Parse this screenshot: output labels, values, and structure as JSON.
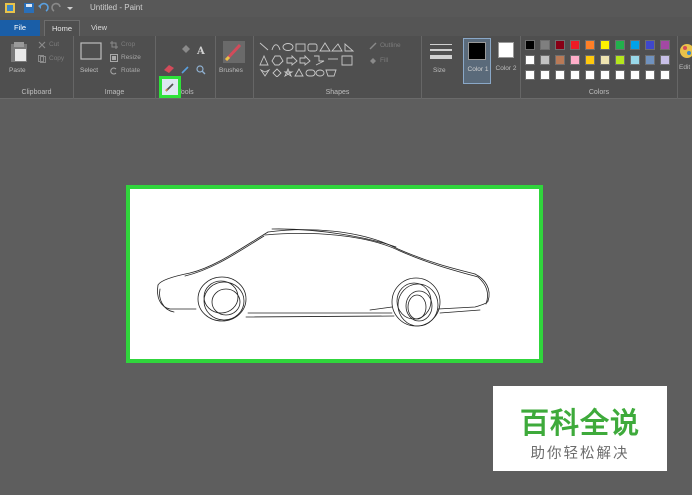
{
  "window": {
    "title": "Untitled - Paint"
  },
  "tabs": {
    "file": "File",
    "home": "Home",
    "view": "View"
  },
  "clipboard": {
    "paste": "Paste",
    "cut": "Cut",
    "copy": "Copy",
    "label": "Clipboard"
  },
  "image": {
    "select": "Select",
    "crop": "Crop",
    "resize": "Resize",
    "rotate": "Rotate",
    "label": "Image"
  },
  "tools": {
    "label": "Tools",
    "selected_tool": "pencil-icon"
  },
  "brushes": {
    "label": "Brushes"
  },
  "shapes": {
    "outline": "Outline",
    "fill": "Fill",
    "label": "Shapes"
  },
  "size": {
    "label": "Size"
  },
  "color1": {
    "label": "Color 1",
    "value": "#000000"
  },
  "color2": {
    "label": "Color 2",
    "value": "#ffffff"
  },
  "colors": {
    "label": "Colors",
    "edit_label": "Edit",
    "row1": [
      "#000000",
      "#7f7f7f",
      "#880015",
      "#ed1c24",
      "#ff7f27",
      "#fff200",
      "#22b14c",
      "#00a2e8",
      "#3f48cc",
      "#a349a4"
    ],
    "row2": [
      "#ffffff",
      "#c3c3c3",
      "#b97a57",
      "#ffaec9",
      "#ffc90e",
      "#efe4b0",
      "#b5e61d",
      "#99d9ea",
      "#7092be",
      "#c8bfe7"
    ]
  },
  "accent": {
    "highlight": "#2ee23a",
    "file_tab": "#1a5ea7"
  },
  "watermark": {
    "title": "百科全说",
    "subtitle": "助你轻松解决"
  }
}
